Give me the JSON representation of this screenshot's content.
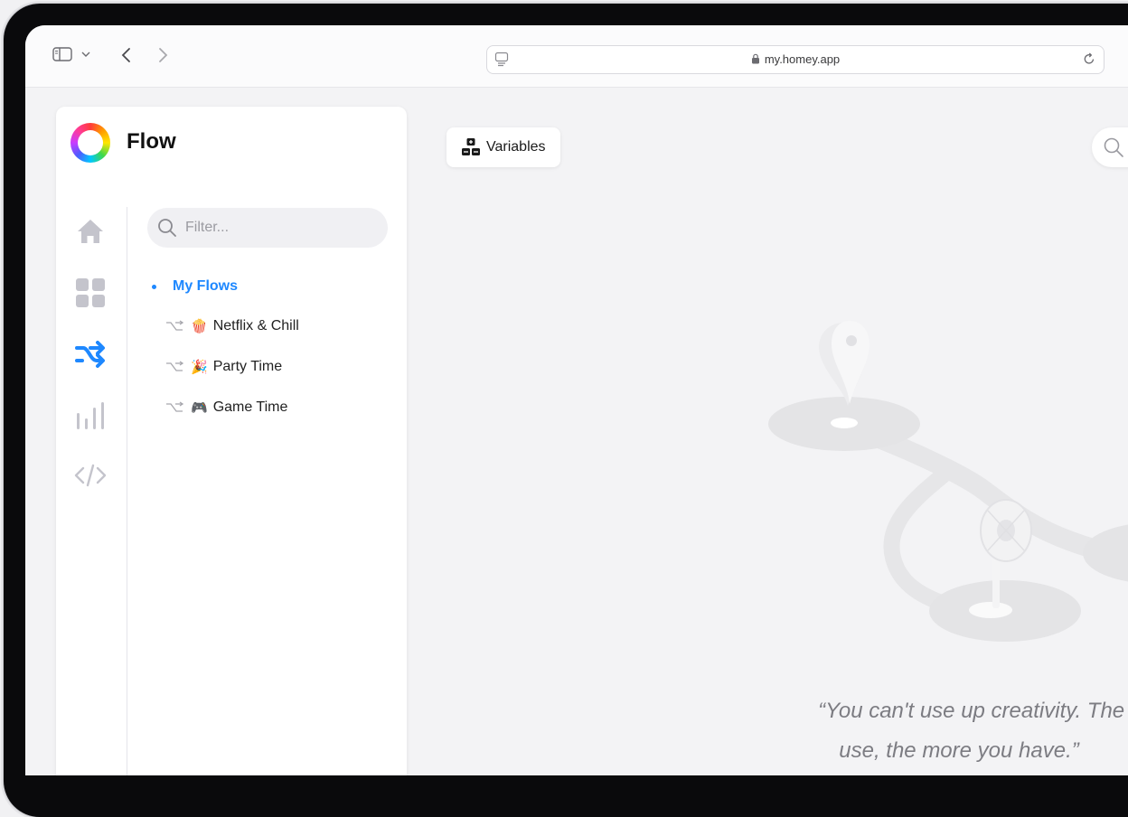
{
  "browser": {
    "url": "my.homey.app"
  },
  "sidebar": {
    "title": "Flow",
    "nav": [
      "home-icon",
      "devices-grid-icon",
      "flow-shuffle-icon",
      "insights-bars-icon",
      "code-icon"
    ],
    "filter_placeholder": "Filter...",
    "folder_label": "My Flows",
    "flows": [
      {
        "emoji": "🍿",
        "label": "Netflix & Chill"
      },
      {
        "emoji": "🎉",
        "label": "Party Time"
      },
      {
        "emoji": "🎮",
        "label": "Game Time"
      }
    ]
  },
  "main": {
    "variables_label": "Variables",
    "quote_line1": "“You can't use up creativity. The m",
    "quote_line2": "use, the more you have.”"
  },
  "colors": {
    "accent": "#1e88ff",
    "nav_inactive": "#c4c4cc"
  }
}
